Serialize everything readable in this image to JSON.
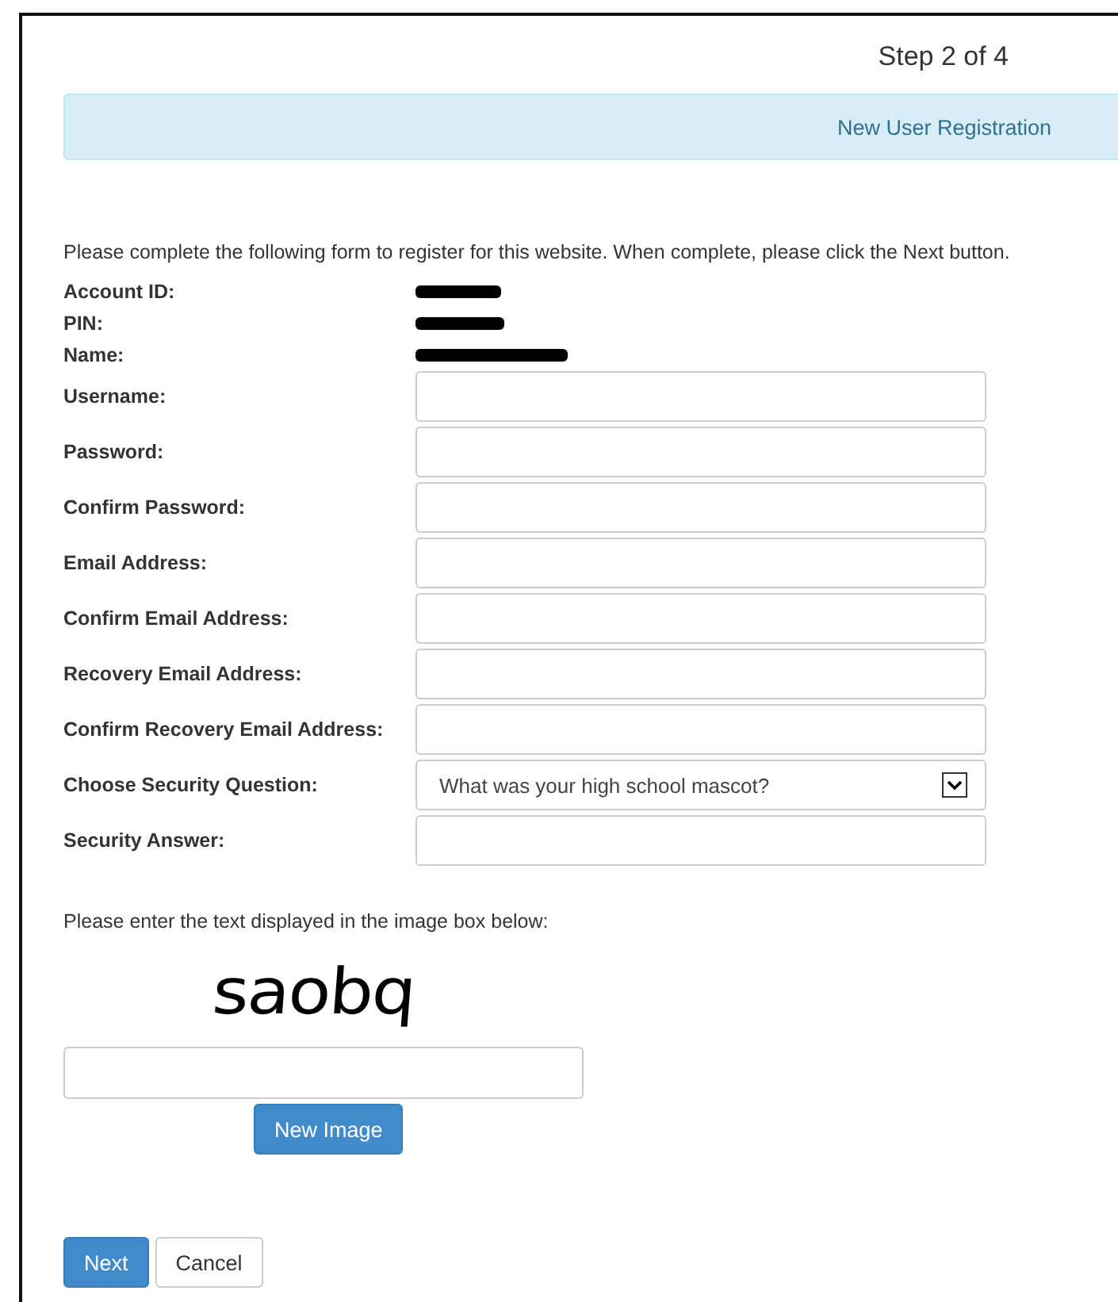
{
  "step": "Step 2 of 4",
  "banner": {
    "title": "New User Registration"
  },
  "intro": "Please complete the following form to register for this website. When complete, please click the Next button.",
  "account_info": [
    {
      "label": "Account ID:",
      "redacted": true
    },
    {
      "label": "PIN:",
      "redacted": true
    },
    {
      "label": "Name:",
      "redacted": true
    }
  ],
  "fields": [
    {
      "kind": "text",
      "label": "Username:"
    },
    {
      "kind": "text",
      "label": "Password:"
    },
    {
      "kind": "text",
      "label": "Confirm Password:"
    },
    {
      "kind": "text",
      "label": "Email Address:"
    },
    {
      "kind": "text",
      "label": "Confirm Email Address:"
    },
    {
      "kind": "text",
      "label": "Recovery Email Address:"
    },
    {
      "kind": "text",
      "label": "Confirm Recovery Email Address:"
    },
    {
      "kind": "select",
      "label": "Choose Security Question:",
      "value": "What was your high school mascot?"
    },
    {
      "kind": "text",
      "label": "Security Answer:"
    }
  ],
  "captcha": {
    "prompt": "Please enter the text displayed in the image box below:",
    "image_text": "saobq",
    "button": "New Image"
  },
  "buttons": [
    {
      "label": "Next",
      "kind": "primary"
    },
    {
      "label": "Cancel",
      "kind": "default"
    }
  ]
}
